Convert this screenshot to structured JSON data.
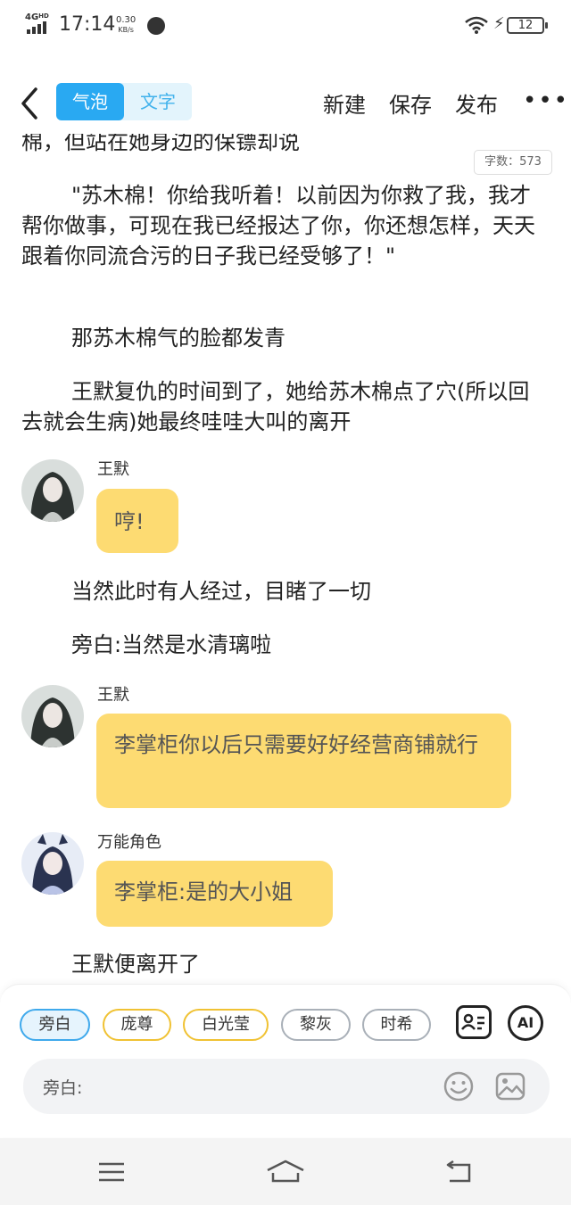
{
  "status_bar": {
    "network": "4G",
    "hd": "HD",
    "time": "17:14",
    "speed_value": "0.30",
    "speed_unit": "KB/s",
    "battery": "12"
  },
  "nav": {
    "tabs": [
      {
        "label": "气泡",
        "active": true
      },
      {
        "label": "文字",
        "active": false
      }
    ],
    "new_label": "新建",
    "save_label": "保存",
    "publish_label": "发布",
    "more_label": "•••"
  },
  "word_count": "字数：573",
  "story": {
    "cut_line": "棉，但站在她身边的保镖却说",
    "p1": "\"苏木棉！你给我听着！以前因为你救了我，我才帮你做事，可现在我已经报达了你，你还想怎样，天天跟着你同流合污的日子我已经受够了！\"",
    "p2": "那苏木棉气的脸都发青",
    "p3": "王默复仇的时间到了，她给苏木棉点了穴(所以回去就会生病)她最终哇哇大叫的离开",
    "msg1": {
      "name": "王默",
      "text": "哼!"
    },
    "p4": "当然此时有人经过，目睹了一切",
    "p5": "旁白:当然是水清璃啦",
    "msg2": {
      "name": "王默",
      "text": "李掌柜你以后只需要好好经营商铺就行"
    },
    "msg3": {
      "name": "万能角色",
      "text": "李掌柜:是的大小姐"
    },
    "p6": "王默便离开了"
  },
  "characters": [
    {
      "label": "旁白",
      "style": "selected"
    },
    {
      "label": "庞尊",
      "style": "yellow"
    },
    {
      "label": "白光莹",
      "style": "yellow"
    },
    {
      "label": "黎灰",
      "style": "gray"
    },
    {
      "label": "时希",
      "style": "gray"
    }
  ],
  "input": {
    "label": "旁白:"
  },
  "tools": {
    "ai_label": "AI"
  },
  "colors": {
    "accent": "#29a9f2",
    "bubble": "#fddb72",
    "chip_yellow": "#f0c233"
  }
}
